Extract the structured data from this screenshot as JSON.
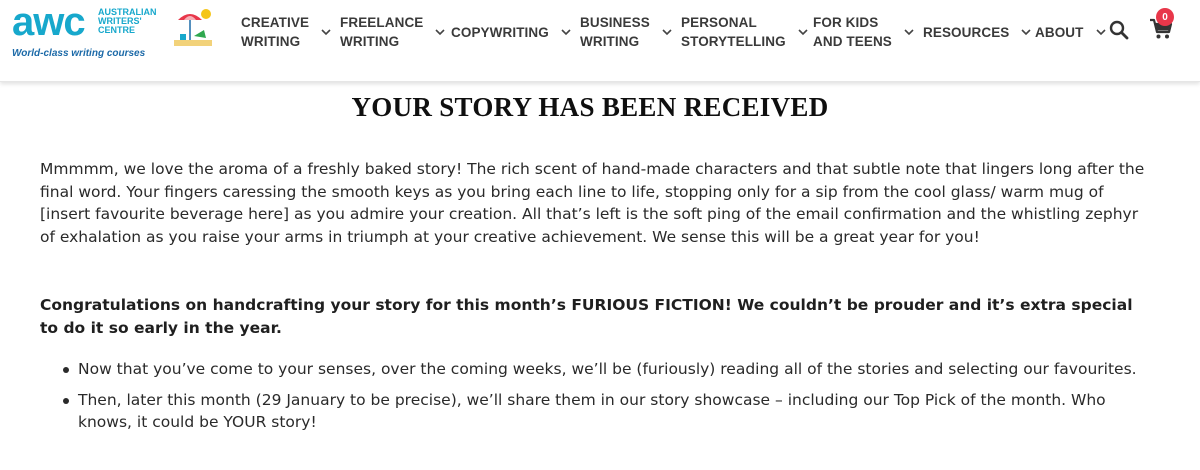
{
  "header": {
    "logo": {
      "wordmark": "awc",
      "name_lines": [
        "AUSTRALIAN",
        "WRITERS'",
        "CENTRE"
      ],
      "tagline": "World-class writing courses"
    },
    "nav": [
      {
        "label": "CREATIVE\nWRITING"
      },
      {
        "label": "FREELANCE\nWRITING"
      },
      {
        "label": "COPYWRITING"
      },
      {
        "label": "BUSINESS\nWRITING"
      },
      {
        "label": "PERSONAL\nSTORYTELLING"
      },
      {
        "label": "FOR KIDS\nAND TEENS"
      },
      {
        "label": "RESOURCES"
      },
      {
        "label": "ABOUT"
      }
    ],
    "cart_count": "0",
    "icons": {
      "search": "search-icon",
      "cart": "cart-icon",
      "chevron": "chevron-down-icon"
    }
  },
  "main": {
    "title": "YOUR STORY HAS BEEN RECEIVED",
    "intro": "Mmmmm, we love the aroma of a freshly baked story! The rich scent of hand-made characters and that subtle note that lingers long after the final word. Your fingers caressing the smooth keys as you bring each line to life, stopping only for a sip from the cool glass/ warm mug of [insert favourite beverage here] as you admire your creation. All that’s left is the soft ping of the email confirmation and the whistling zephyr of exhalation as you raise your arms in triumph at your creative achievement. We sense this will be a great year for you!",
    "congrats": "Congratulations on handcrafting your story for this month’s FURIOUS FICTION! We couldn’t be prouder and it’s extra special to do it so early in the year.",
    "bullets": [
      "Now that you’ve come to your senses, over the coming weeks, we’ll be (furiously) reading all of the stories and selecting our favourites.",
      "Then, later this month (29 January to be precise), we’ll share them in our story showcase – including our Top Pick of the month. Who knows, it could be YOUR story!"
    ]
  },
  "colors": {
    "brand": "#17a8cc",
    "brand_dark": "#1c6aa8",
    "badge": "#e8374a",
    "nav_text": "#3a3a3a"
  }
}
